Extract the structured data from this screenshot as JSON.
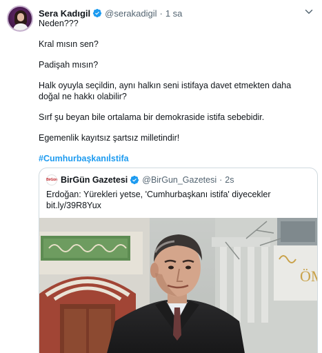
{
  "tweet": {
    "author_name": "Sera Kadıgil",
    "handle": "@serakadigil",
    "separator": "·",
    "time": "1 sa",
    "paragraphs": [
      "Neden???",
      "Kral mısın sen?",
      "Padişah mısın?",
      "Halk oyuyla seçildin, aynı halkın seni istifaya davet etmekten daha doğal ne hakkı olabilir?",
      "Sırf şu beyan bile ortalama bir demokraside istifa sebebidir.",
      "Egemenlik kayıtsız şartsız milletindir!"
    ],
    "hashtag": "#Cumhurbaşkanıİstifa"
  },
  "quote": {
    "logo_text": "BirGün",
    "author_name": "BirGün Gazetesi",
    "handle": "@BirGun_Gazetesi",
    "separator": "·",
    "time": "2s",
    "text_line1": "Erdoğan: Yürekleri yetse, 'Cumhurbaşkanı istifa' diyecekler",
    "text_line2": "bit.ly/39R8Yux",
    "photo_sign_text": "ÖM"
  },
  "icons": {
    "verified": "verified-badge-icon",
    "more": "chevron-down-icon"
  },
  "colors": {
    "accent": "#1d9bf0",
    "secondary_text": "#536471",
    "border": "#cfd9de"
  }
}
